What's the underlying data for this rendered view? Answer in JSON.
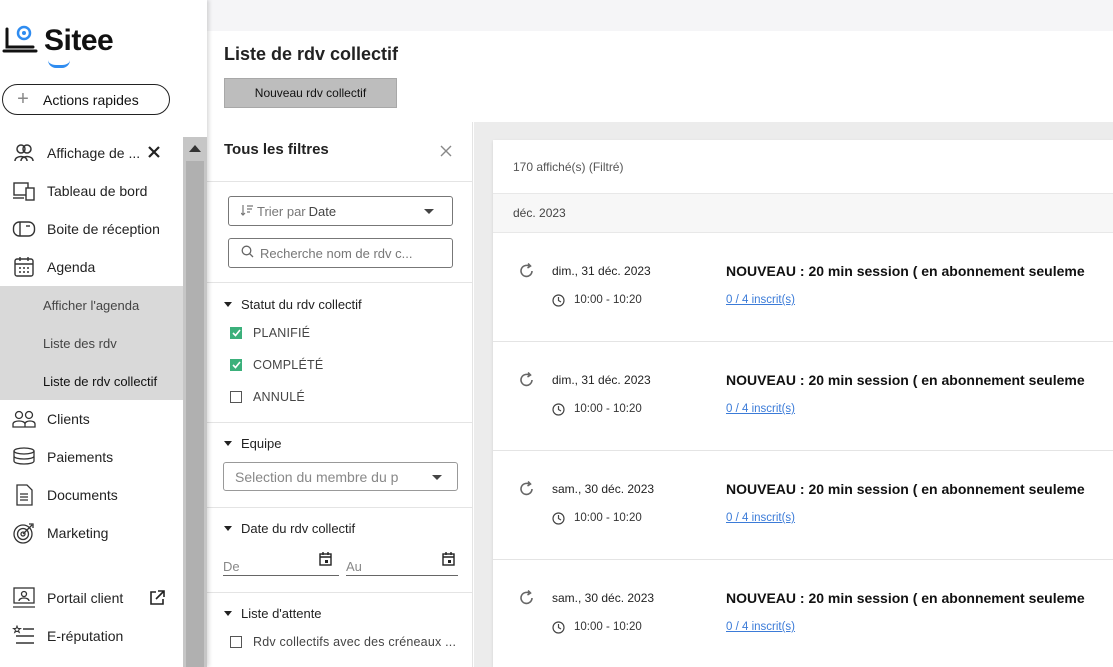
{
  "brand": {
    "name": "Sitee",
    "accent": "#2f8cf0"
  },
  "sidebar": {
    "quick_actions": "Actions rapides",
    "items": [
      {
        "label": "Affichage de ...",
        "icon": "users-group-icon"
      },
      {
        "label": "Tableau de bord",
        "icon": "dashboard-icon"
      },
      {
        "label": "Boite de réception",
        "icon": "mailbox-icon"
      },
      {
        "label": "Agenda",
        "icon": "calendar-icon"
      },
      {
        "label": "Clients",
        "icon": "clients-icon"
      },
      {
        "label": "Paiements",
        "icon": "coins-icon"
      },
      {
        "label": "Documents",
        "icon": "document-icon"
      },
      {
        "label": "Marketing",
        "icon": "target-icon"
      },
      {
        "label": "Portail client",
        "icon": "portal-icon"
      },
      {
        "label": "E-réputation",
        "icon": "reputation-icon"
      }
    ],
    "agenda_sub": [
      {
        "label": "Afficher l'agenda"
      },
      {
        "label": "Liste des rdv"
      },
      {
        "label": "Liste de rdv collectif",
        "active": true
      }
    ]
  },
  "header": {
    "title": "Liste de rdv collectif",
    "new_button": "Nouveau rdv collectif"
  },
  "filters": {
    "title": "Tous les filtres",
    "sort_prefix": "Trier par",
    "sort_value": "Date",
    "search_placeholder": "Recherche nom de rdv c...",
    "status": {
      "title": "Statut du rdv collectif",
      "options": [
        {
          "label": "PLANIFIÉ",
          "checked": true
        },
        {
          "label": "COMPLÉTÉ",
          "checked": true
        },
        {
          "label": "ANNULÉ",
          "checked": false
        }
      ]
    },
    "team": {
      "title": "Equipe",
      "placeholder": "Selection du membre du p"
    },
    "date": {
      "title": "Date du rdv collectif",
      "from": "De",
      "to": "Au"
    },
    "waitlist": {
      "title": "Liste d'attente",
      "option": "Rdv collectifs avec des créneaux ..."
    }
  },
  "list": {
    "count": "170 affiché(s) (Filtré)",
    "month": "déc. 2023",
    "rows": [
      {
        "date": "dim., 31 déc. 2023",
        "time": "10:00 - 10:20",
        "title": "NOUVEAU : 20 min session ( en abonnement seuleme",
        "enrolled": "0 / 4 inscrit(s)"
      },
      {
        "date": "dim., 31 déc. 2023",
        "time": "10:00 - 10:20",
        "title": "NOUVEAU : 20 min session ( en abonnement seuleme",
        "enrolled": "0 / 4 inscrit(s)"
      },
      {
        "date": "sam., 30 déc. 2023",
        "time": "10:00 - 10:20",
        "title": "NOUVEAU : 20 min session ( en abonnement seuleme",
        "enrolled": "0 / 4 inscrit(s)"
      },
      {
        "date": "sam., 30 déc. 2023",
        "time": "10:00 - 10:20",
        "title": "NOUVEAU : 20 min session ( en abonnement seuleme",
        "enrolled": "0 / 4 inscrit(s)"
      }
    ]
  }
}
